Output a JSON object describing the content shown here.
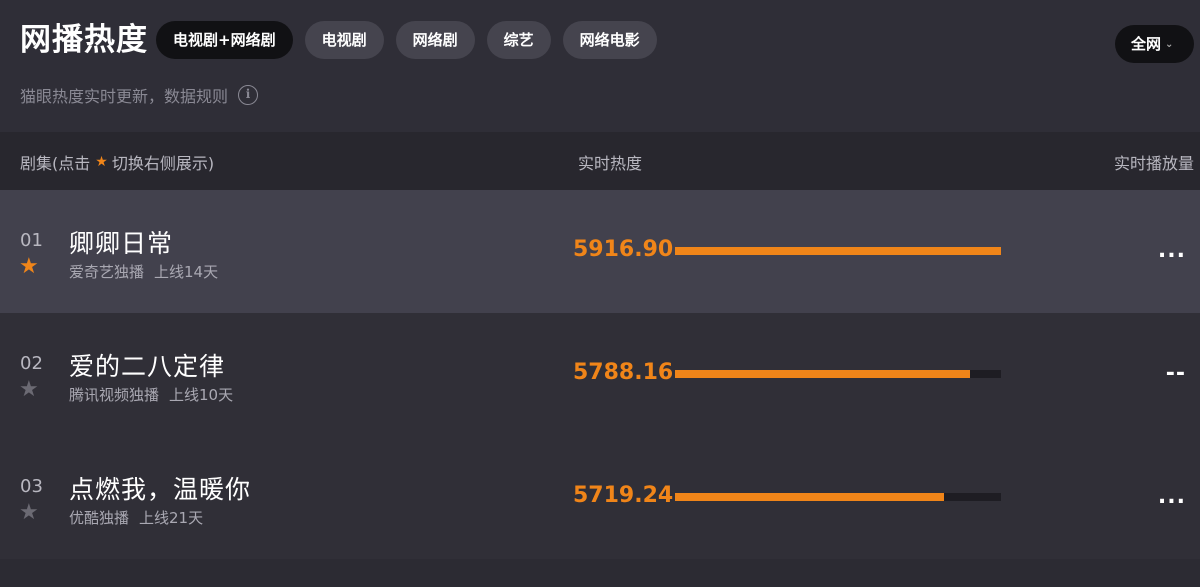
{
  "header": {
    "title": "网播热度",
    "tabs": [
      {
        "label": "电视剧+网络剧",
        "active": true
      },
      {
        "label": "电视剧",
        "active": false
      },
      {
        "label": "网络剧",
        "active": false
      },
      {
        "label": "综艺",
        "active": false
      },
      {
        "label": "网络电影",
        "active": false
      }
    ],
    "region": "全网",
    "subtitle": "猫眼热度实时更新，数据规则",
    "info_icon": "i"
  },
  "columns": {
    "title_prefix": "剧集(点击",
    "title_suffix": "切换右侧展示)",
    "heat": "实时热度",
    "plays": "实时播放量"
  },
  "rows": [
    {
      "rank": "01",
      "title": "卿卿日常",
      "platform": "爱奇艺独播",
      "days": "上线14天",
      "heat": "5916.90",
      "heat_ratio": 1.0,
      "plays": "...",
      "starred": true
    },
    {
      "rank": "02",
      "title": "爱的二八定律",
      "platform": "腾讯视频独播",
      "days": "上线10天",
      "heat": "5788.16",
      "heat_ratio": 0.905,
      "plays": "--",
      "starred": false
    },
    {
      "rank": "03",
      "title": "点燃我，温暖你",
      "platform": "优酷独播",
      "days": "上线21天",
      "heat": "5719.24",
      "heat_ratio": 0.825,
      "plays": "...",
      "starred": false
    }
  ],
  "colors": {
    "accent": "#f08519",
    "active_tab": "#111114",
    "highlight_row": "#42414d"
  }
}
